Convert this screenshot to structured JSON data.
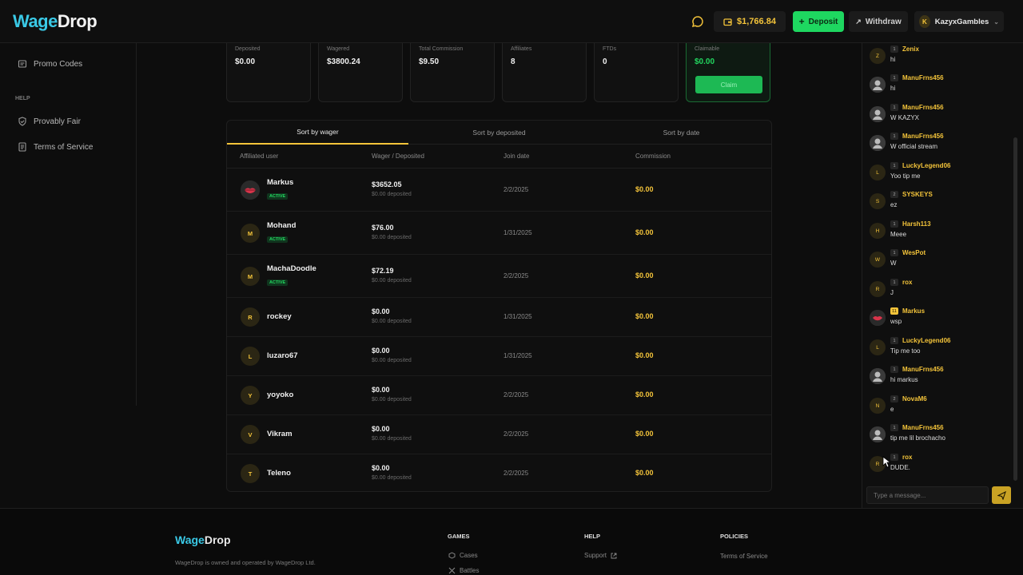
{
  "header": {
    "logo_wage": "Wage",
    "logo_drop": "Drop",
    "balance": "$1,766.84",
    "deposit_label": "Deposit",
    "withdraw_label": "Withdraw",
    "username": "KazyxGambles",
    "user_initial": "K"
  },
  "sidebar": {
    "promo_codes": "Promo Codes",
    "help_heading": "HELP",
    "provably_fair": "Provably Fair",
    "terms": "Terms of Service"
  },
  "stats": [
    {
      "label": "Deposited",
      "value": "$0.00"
    },
    {
      "label": "Wagered",
      "value": "$3800.24"
    },
    {
      "label": "Total Commission",
      "value": "$9.50"
    },
    {
      "label": "Affiliates",
      "value": "8"
    },
    {
      "label": "FTDs",
      "value": "0"
    },
    {
      "label": "Claimable",
      "value": "$0.00"
    }
  ],
  "claim_label": "Claim",
  "tabs": [
    "Sort by wager",
    "Sort by deposited",
    "Sort by date"
  ],
  "columns": [
    "Affiliated user",
    "Wager / Deposited",
    "Join date",
    "Commission"
  ],
  "rows": [
    {
      "initial": "",
      "name": "Markus",
      "status": "ACTIVE",
      "wager": "$3652.05",
      "deposited": "$0.00 deposited",
      "date": "2/2/2025",
      "commission": "$0.00"
    },
    {
      "initial": "M",
      "name": "Mohand",
      "status": "ACTIVE",
      "wager": "$76.00",
      "deposited": "$0.00 deposited",
      "date": "1/31/2025",
      "commission": "$0.00"
    },
    {
      "initial": "M",
      "name": "MachaDoodle",
      "status": "ACTIVE",
      "wager": "$72.19",
      "deposited": "$0.00 deposited",
      "date": "2/2/2025",
      "commission": "$0.00"
    },
    {
      "initial": "R",
      "name": "rockey",
      "status": "",
      "wager": "$0.00",
      "deposited": "$0.00 deposited",
      "date": "1/31/2025",
      "commission": "$0.00"
    },
    {
      "initial": "L",
      "name": "luzaro67",
      "status": "",
      "wager": "$0.00",
      "deposited": "$0.00 deposited",
      "date": "1/31/2025",
      "commission": "$0.00"
    },
    {
      "initial": "Y",
      "name": "yoyoko",
      "status": "",
      "wager": "$0.00",
      "deposited": "$0.00 deposited",
      "date": "2/2/2025",
      "commission": "$0.00"
    },
    {
      "initial": "V",
      "name": "Vikram",
      "status": "",
      "wager": "$0.00",
      "deposited": "$0.00 deposited",
      "date": "2/2/2025",
      "commission": "$0.00"
    },
    {
      "initial": "T",
      "name": "Teleno",
      "status": "",
      "wager": "$0.00",
      "deposited": "$0.00 deposited",
      "date": "2/2/2025",
      "commission": "$0.00"
    }
  ],
  "chat": {
    "messages": [
      {
        "initial": "Z",
        "level": "1",
        "name": "Zenix",
        "text": "hi"
      },
      {
        "initial": "",
        "level": "1",
        "name": "ManuFrns456",
        "text": "hi"
      },
      {
        "initial": "",
        "level": "1",
        "name": "ManuFrns456",
        "text": "W KAZYX"
      },
      {
        "initial": "",
        "level": "1",
        "name": "ManuFrns456",
        "text": "W official stream"
      },
      {
        "initial": "L",
        "level": "1",
        "name": "LuckyLegend06",
        "text": "Yoo tip me"
      },
      {
        "initial": "S",
        "level": "2",
        "name": "SYSKEYS",
        "text": "ez"
      },
      {
        "initial": "H",
        "level": "1",
        "name": "Harsh113",
        "text": "Meee"
      },
      {
        "initial": "W",
        "level": "1",
        "name": "WesPot",
        "text": "W"
      },
      {
        "initial": "R",
        "level": "1",
        "name": "rox",
        "text": "J"
      },
      {
        "initial": "",
        "level": "11",
        "name": "Markus",
        "text": "wsp"
      },
      {
        "initial": "L",
        "level": "1",
        "name": "LuckyLegend06",
        "text": "Tip me too"
      },
      {
        "initial": "",
        "level": "1",
        "name": "ManuFrns456",
        "text": "hi markus"
      },
      {
        "initial": "N",
        "level": "2",
        "name": "NovaM6",
        "text": "e"
      },
      {
        "initial": "",
        "level": "1",
        "name": "ManuFrns456",
        "text": "tip me lil brochacho"
      },
      {
        "initial": "R",
        "level": "1",
        "name": "rox",
        "text": "DUDE."
      }
    ],
    "placeholder": "Type a message..."
  },
  "footer": {
    "logo_wage": "Wage",
    "logo_drop": "Drop",
    "desc": "WageDrop is owned and operated by WageDrop Ltd.",
    "games_heading": "GAMES",
    "cases": "Cases",
    "battles": "Battles",
    "help_heading": "HELP",
    "support": "Support",
    "policies_heading": "POLICIES",
    "terms": "Terms of Service"
  },
  "colors": {
    "accent": "#f4c43a",
    "brand": "#3ac9e6",
    "success": "#1ed760"
  }
}
